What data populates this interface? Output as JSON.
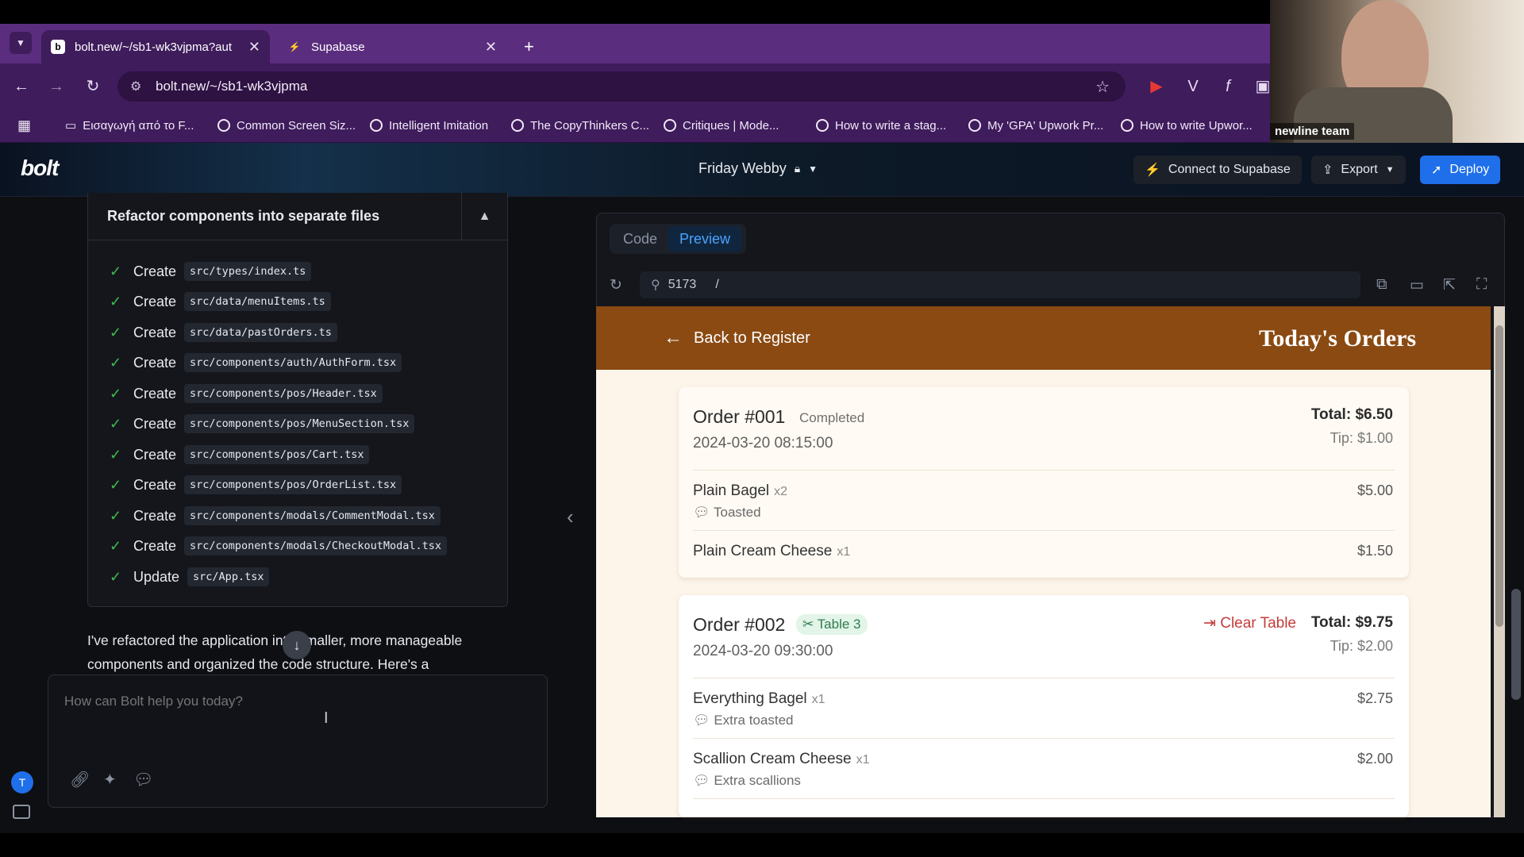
{
  "browser": {
    "tabs": [
      {
        "title": "bolt.new/~/sb1-wk3vjpma?aut",
        "favicon": "b"
      },
      {
        "title": "Supabase",
        "favicon": "supabase-icon"
      }
    ],
    "url": "bolt.new/~/sb1-wk3vjpma",
    "bookmarks": [
      "Εισαγωγή από το F...",
      "Common Screen Siz...",
      "Intelligent Imitation",
      "The CopyThinkers C...",
      "Critiques | Mode...",
      "How to write a stag...",
      "My 'GPA' Upwork Pr...",
      "How to write Upwor..."
    ]
  },
  "webcam": {
    "label": "newline team"
  },
  "app": {
    "logo": "bolt",
    "project": "Friday Webby",
    "connect_label": "Connect to Supabase",
    "export_label": "Export",
    "deploy_label": "Deploy"
  },
  "chat": {
    "task_title": "Refactor components into separate files",
    "steps": [
      {
        "action": "Create",
        "file": "src/types/index.ts"
      },
      {
        "action": "Create",
        "file": "src/data/menuItems.ts"
      },
      {
        "action": "Create",
        "file": "src/data/pastOrders.ts"
      },
      {
        "action": "Create",
        "file": "src/components/auth/AuthForm.tsx"
      },
      {
        "action": "Create",
        "file": "src/components/pos/Header.tsx"
      },
      {
        "action": "Create",
        "file": "src/components/pos/MenuSection.tsx"
      },
      {
        "action": "Create",
        "file": "src/components/pos/Cart.tsx"
      },
      {
        "action": "Create",
        "file": "src/components/pos/OrderList.tsx"
      },
      {
        "action": "Create",
        "file": "src/components/modals/CommentModal.tsx"
      },
      {
        "action": "Create",
        "file": "src/components/modals/CheckoutModal.tsx"
      },
      {
        "action": "Update",
        "file": "src/App.tsx"
      }
    ],
    "reply_line1": "I've refactored the application into smaller, more manageable",
    "reply_line2": "components and organized the code structure. Here's a",
    "prompt_placeholder": "How can Bolt help you today?",
    "user_initial": "T"
  },
  "preview": {
    "tabs": {
      "code": "Code",
      "preview": "Preview"
    },
    "port": "5173",
    "path": "/",
    "back_label": "Back to Register",
    "title": "Today's Orders",
    "orders": [
      {
        "id": "Order #001",
        "status": "Completed",
        "datetime": "2024-03-20 08:15:00",
        "total": "Total: $6.50",
        "tip": "Tip: $1.00",
        "items": [
          {
            "name": "Plain Bagel",
            "qty": "x2",
            "note": "Toasted",
            "price": "$5.00"
          },
          {
            "name": "Plain Cream Cheese",
            "qty": "x1",
            "note": "",
            "price": "$1.50"
          }
        ]
      },
      {
        "id": "Order #002",
        "status": "Table 3",
        "clear_label": "Clear Table",
        "datetime": "2024-03-20 09:30:00",
        "total": "Total: $9.75",
        "tip": "Tip: $2.00",
        "items": [
          {
            "name": "Everything Bagel",
            "qty": "x1",
            "note": "Extra toasted",
            "price": "$2.75"
          },
          {
            "name": "Scallion Cream Cheese",
            "qty": "x1",
            "note": "Extra scallions",
            "price": "$2.00"
          }
        ]
      }
    ]
  },
  "colors": {
    "tab_strip": "#5b2d7e",
    "app_bg": "#0d0f12",
    "deploy": "#1f6feb",
    "orders_header": "#8a4a12",
    "preview_bg": "#fdf5ea",
    "check": "#3fb950",
    "clear": "#c53b3b"
  }
}
